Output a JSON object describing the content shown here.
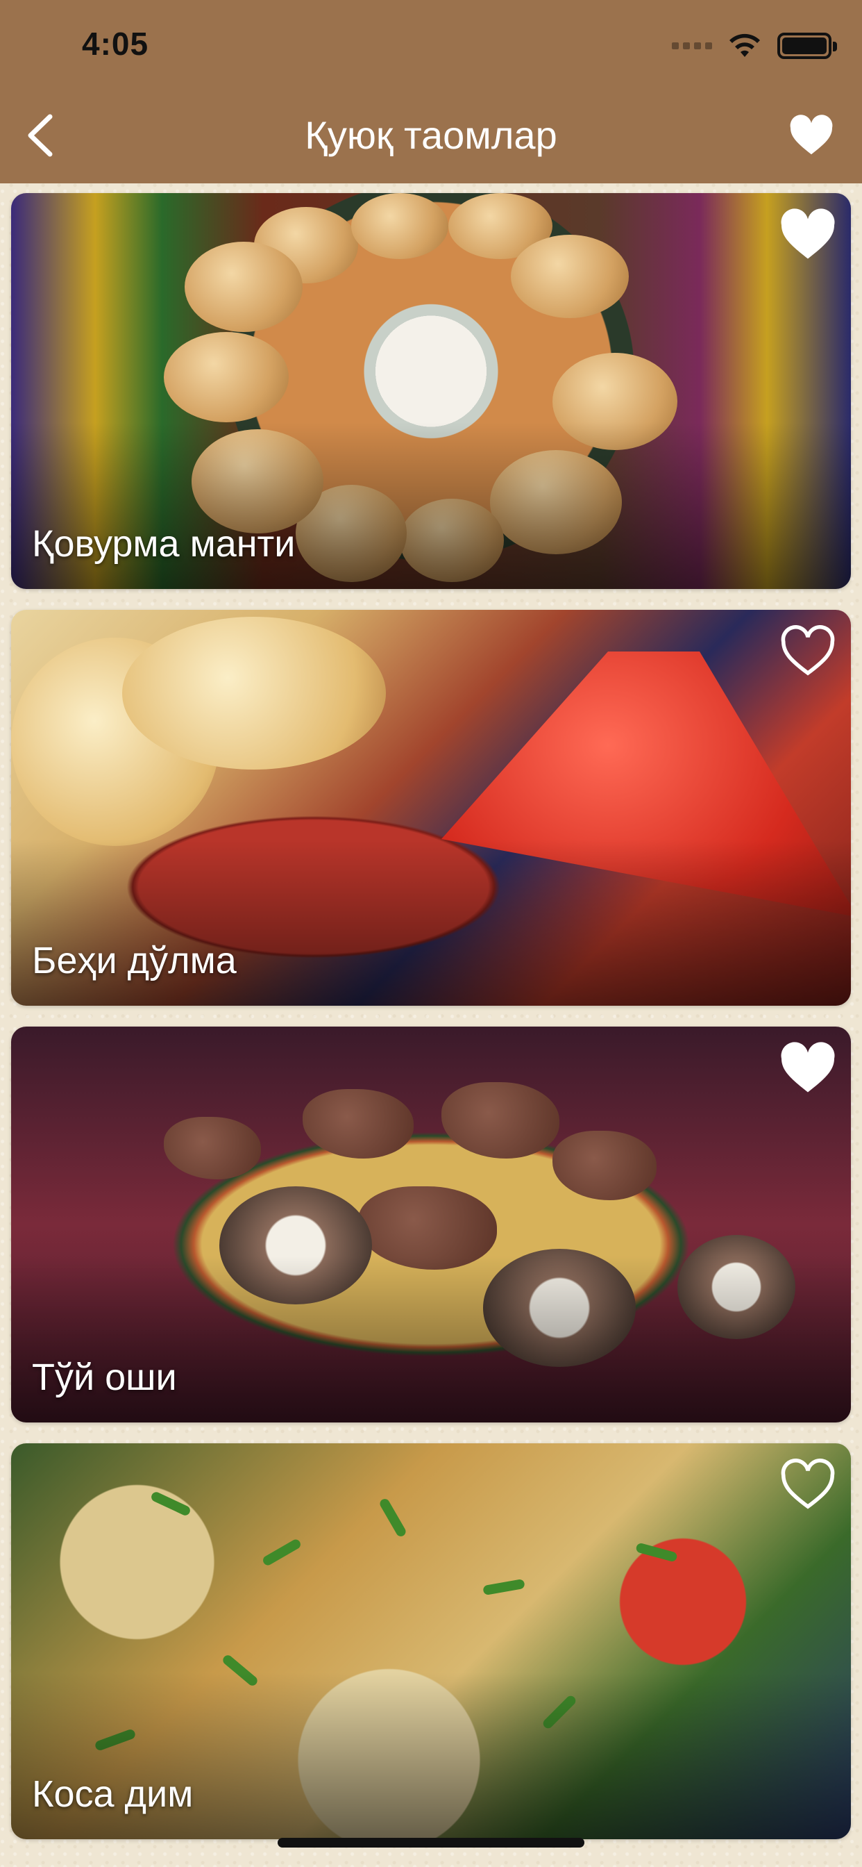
{
  "status_bar": {
    "time": "4:05"
  },
  "nav": {
    "title": "Қуюқ таомлар"
  },
  "items": [
    {
      "label": "Қовурма манти",
      "favorited": true
    },
    {
      "label": "Беҳи дўлма",
      "favorited": false
    },
    {
      "label": "Тўй оши",
      "favorited": true
    },
    {
      "label": "Коса дим",
      "favorited": false
    }
  ],
  "icons": {
    "back": "chevron-left-icon",
    "nav_favorite": "heart-filled-icon",
    "favorited": "heart-filled-icon",
    "not_favorited": "heart-outline-icon"
  },
  "colors": {
    "header": "#9b724d",
    "background": "#efe6d3",
    "text_on_header": "#ffffff"
  }
}
